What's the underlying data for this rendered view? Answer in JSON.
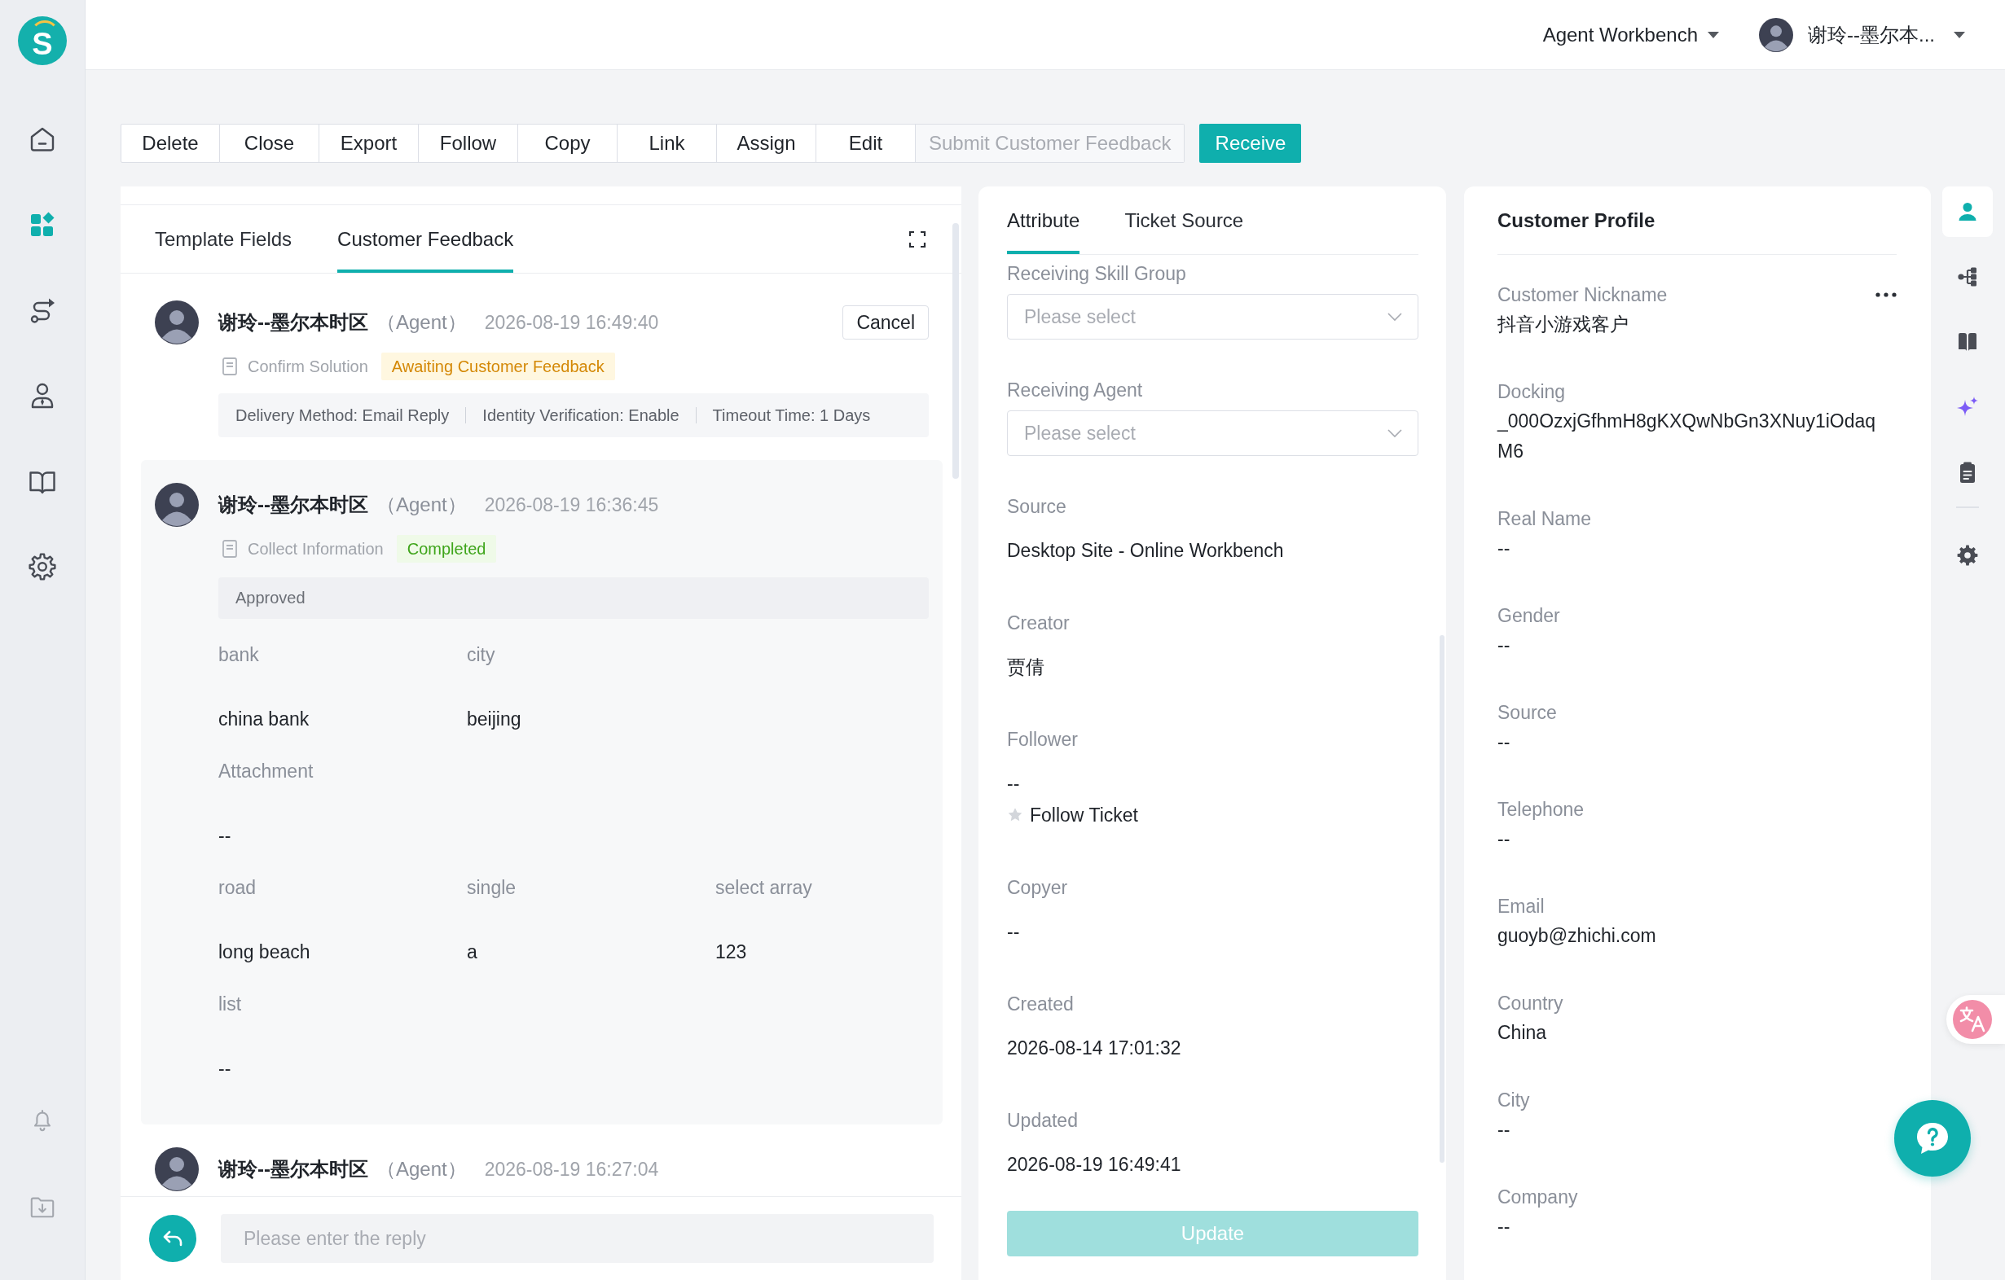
{
  "sidebar": {
    "logo": "S",
    "nav": [
      {
        "selected": false
      },
      {
        "selected": true
      },
      {
        "selected": false
      },
      {
        "selected": false
      },
      {
        "selected": false
      },
      {
        "selected": false
      }
    ]
  },
  "header": {
    "workspace": "Agent Workbench",
    "user": "谢玲--墨尔本..."
  },
  "toolbar": {
    "buttons": [
      {
        "label": "Delete",
        "disabled": false
      },
      {
        "label": "Close",
        "disabled": false
      },
      {
        "label": "Export",
        "disabled": false
      },
      {
        "label": "Follow",
        "disabled": false
      },
      {
        "label": "Copy",
        "disabled": false
      },
      {
        "label": "Link",
        "disabled": false
      },
      {
        "label": "Assign",
        "disabled": false
      },
      {
        "label": "Edit",
        "disabled": false
      },
      {
        "label": "Submit Customer Feedback",
        "disabled": true
      }
    ],
    "primary": "Receive"
  },
  "feedback": {
    "tabs": [
      {
        "label": "Template Fields",
        "selected": false
      },
      {
        "label": "Customer Feedback",
        "selected": true
      }
    ],
    "entries": [
      {
        "kind": "plain",
        "author": "谢玲--墨尔本时区",
        "role": "（Agent）",
        "time": "2026-08-19 16:49:40",
        "action": "Cancel",
        "step": "Confirm Solution",
        "status": {
          "label": "Awaiting Customer Feedback",
          "kind": "pending"
        },
        "details": [
          "Delivery Method: Email Reply",
          "Identity Verification: Enable",
          "Timeout Time: 1 Days"
        ]
      },
      {
        "kind": "card",
        "author": "谢玲--墨尔本时区",
        "role": "（Agent）",
        "time": "2026-08-19 16:36:45",
        "step": "Collect Information",
        "status": {
          "label": "Completed",
          "kind": "done"
        },
        "note": "Approved",
        "field_rows": [
          {
            "fields": [
              {
                "label": "bank",
                "value": "china bank"
              },
              {
                "label": "city",
                "value": "beijing"
              }
            ]
          },
          {
            "fields": [
              {
                "label": "Attachment",
                "value": "--"
              }
            ]
          },
          {
            "fields": [
              {
                "label": "road",
                "value": "long beach"
              },
              {
                "label": "single",
                "value": "a"
              },
              {
                "label": "select array",
                "value": "123"
              }
            ]
          },
          {
            "fields": [
              {
                "label": "list",
                "value": "--"
              }
            ]
          }
        ]
      },
      {
        "kind": "plain",
        "author": "谢玲--墨尔本时区",
        "role": "（Agent）",
        "time": "2026-08-19 16:27:04"
      }
    ],
    "reply": {
      "placeholder": "Please enter the reply"
    }
  },
  "attributes": {
    "tabs": [
      {
        "label": "Attribute",
        "selected": true
      },
      {
        "label": "Ticket Source",
        "selected": false
      }
    ],
    "fields": [
      {
        "kind": "select",
        "label": "Receiving Skill Group",
        "placeholder": "Please select"
      },
      {
        "kind": "select",
        "label": "Receiving Agent",
        "placeholder": "Please select"
      },
      {
        "kind": "text",
        "label": "Source",
        "value": "Desktop Site - Online Workbench"
      },
      {
        "kind": "text",
        "label": "Creator",
        "value": "贾倩"
      },
      {
        "kind": "text",
        "label": "Follower",
        "value": "--",
        "follow": {
          "label": "Follow Ticket",
          "starred": false
        }
      },
      {
        "kind": "text",
        "label": "Copyer",
        "value": "--"
      },
      {
        "kind": "text",
        "label": "Created",
        "value": "2026-08-14 17:01:32"
      },
      {
        "kind": "text",
        "label": "Updated",
        "value": "2026-08-19 16:49:41"
      }
    ],
    "update": {
      "label": "Update",
      "disabled": true
    }
  },
  "profile": {
    "title": "Customer Profile",
    "fields": [
      {
        "label": "Customer Nickname",
        "value": "抖音小游戏客户"
      },
      {
        "label": "Docking",
        "value": "_000OzxjGfhmH8gKXQwNbGn3XNuy1iOdaqM6"
      },
      {
        "label": "Real Name",
        "value": "--"
      },
      {
        "label": "Gender",
        "value": "--"
      },
      {
        "label": "Source",
        "value": "--"
      },
      {
        "label": "Telephone",
        "value": "--"
      },
      {
        "label": "Email",
        "value": "guoyb@zhichi.com"
      },
      {
        "label": "Country",
        "value": "China"
      },
      {
        "label": "City",
        "value": "--"
      },
      {
        "label": "Company",
        "value": "--"
      }
    ]
  },
  "rail": [
    {
      "items": [
        {
          "selected": true
        },
        {
          "selected": false
        },
        {
          "selected": false
        },
        {
          "selected": false
        },
        {
          "selected": false
        }
      ]
    },
    {
      "items": [
        {
          "selected": false
        }
      ]
    }
  ]
}
